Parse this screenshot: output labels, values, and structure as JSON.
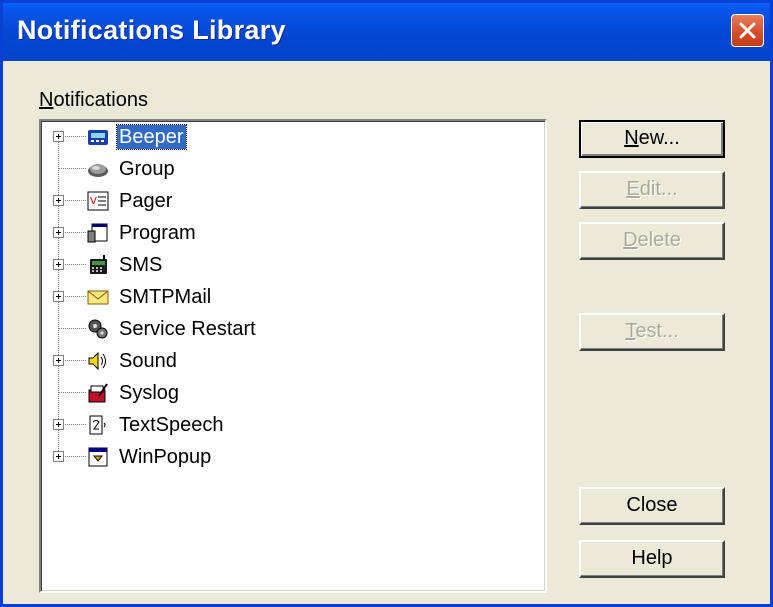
{
  "window": {
    "title": "Notifications Library"
  },
  "panel": {
    "label_prefix": "N",
    "label_rest": "otifications"
  },
  "tree": {
    "items": [
      {
        "label": "Beeper",
        "icon": "beeper-icon",
        "expandable": true,
        "selected": true
      },
      {
        "label": "Group",
        "icon": "group-icon",
        "expandable": false,
        "selected": false
      },
      {
        "label": "Pager",
        "icon": "pager-icon",
        "expandable": true,
        "selected": false
      },
      {
        "label": "Program",
        "icon": "program-icon",
        "expandable": true,
        "selected": false
      },
      {
        "label": "SMS",
        "icon": "sms-icon",
        "expandable": true,
        "selected": false
      },
      {
        "label": "SMTPMail",
        "icon": "mail-icon",
        "expandable": true,
        "selected": false
      },
      {
        "label": "Service Restart",
        "icon": "service-restart-icon",
        "expandable": false,
        "selected": false
      },
      {
        "label": "Sound",
        "icon": "sound-icon",
        "expandable": true,
        "selected": false
      },
      {
        "label": "Syslog",
        "icon": "syslog-icon",
        "expandable": false,
        "selected": false
      },
      {
        "label": "TextSpeech",
        "icon": "text-speech-icon",
        "expandable": true,
        "selected": false
      },
      {
        "label": "WinPopup",
        "icon": "winpopup-icon",
        "expandable": true,
        "selected": false
      }
    ]
  },
  "buttons": {
    "new": {
      "mnemonic": "N",
      "rest": "ew...",
      "enabled": true
    },
    "edit": {
      "mnemonic": "E",
      "rest": "dit...",
      "enabled": false
    },
    "delete": {
      "mnemonic": "D",
      "rest": "elete",
      "enabled": false
    },
    "test": {
      "mnemonic": "T",
      "rest": "est...",
      "enabled": false
    },
    "close": {
      "label": "Close",
      "enabled": true
    },
    "help": {
      "label": "Help",
      "enabled": true
    }
  },
  "colors": {
    "titlebar": "#0347d3",
    "selection": "#316ac5",
    "close_button": "#d4502c"
  }
}
